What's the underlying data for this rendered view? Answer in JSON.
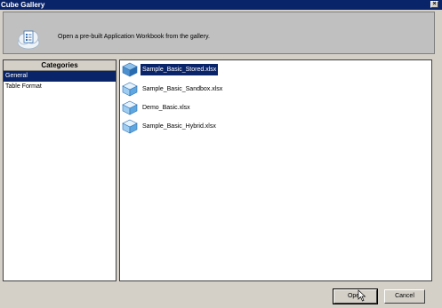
{
  "window": {
    "title": "Cube Gallery",
    "close_label": "×"
  },
  "header": {
    "message": "Open a pre-built Application Workbook from the gallery.",
    "icon": "workbook-cloud-icon"
  },
  "categories": {
    "title": "Categories",
    "items": [
      {
        "label": "General",
        "selected": true
      },
      {
        "label": "Table Format",
        "selected": false
      }
    ]
  },
  "files": [
    {
      "label": "Sample_Basic_Stored.xlsx",
      "selected": true,
      "icon": "cube-icon"
    },
    {
      "label": "Sample_Basic_Sandbox.xlsx",
      "selected": false,
      "icon": "cube-icon"
    },
    {
      "label": "Demo_Basic.xlsx",
      "selected": false,
      "icon": "cube-icon"
    },
    {
      "label": "Sample_Basic_Hybrid.xlsx",
      "selected": false,
      "icon": "cube-icon"
    }
  ],
  "buttons": {
    "open_label": "Open",
    "cancel_label": "Cancel"
  },
  "colors": {
    "selection": "#0a246a",
    "dialog_bg": "#d4d0c8",
    "cube": "#4d90d0"
  }
}
